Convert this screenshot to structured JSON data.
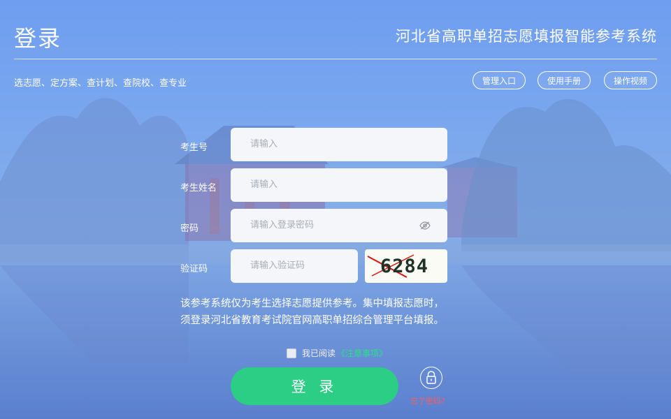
{
  "header": {
    "title": "登录",
    "system_name": "河北省高职单招志愿填报智能参考系统",
    "subtitle": "选志愿、定方案、查计划、查院校、查专业",
    "buttons": [
      {
        "label": "管理入口"
      },
      {
        "label": "使用手册"
      },
      {
        "label": "操作视频"
      }
    ]
  },
  "form": {
    "exam_number": {
      "label": "考生号",
      "placeholder": "请输入"
    },
    "student_name": {
      "label": "考生姓名",
      "placeholder": "请输入"
    },
    "password": {
      "label": "密码",
      "placeholder": "请输入登录密码"
    },
    "captcha": {
      "label": "验证码",
      "placeholder": "请输入验证码",
      "image_text": "6284"
    }
  },
  "notice": {
    "line1": "该参考系统仅为考生选择志愿提供参考。集中填报志愿时，",
    "line2": "须登录河北省教育考试院官网高职单招综合管理平台填报。"
  },
  "agreement": {
    "prefix": "我已阅读",
    "link": "《注意事项》"
  },
  "login_button": "登 录",
  "forgot_password": "忘了密码?",
  "colors": {
    "primary_green": "#2ccd84",
    "link_green": "#27e08a",
    "forgot_red": "#ff5c5c"
  }
}
